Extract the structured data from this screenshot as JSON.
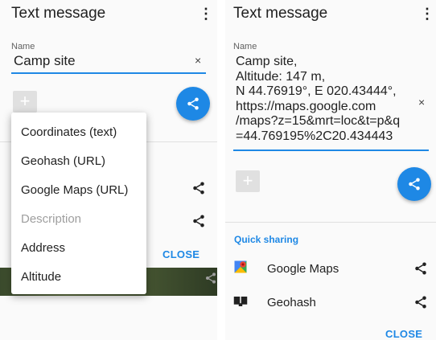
{
  "left": {
    "title": "Text message",
    "name_label": "Name",
    "name_value": "Camp site",
    "clear_glyph": "×",
    "menu_items": [
      {
        "label": "Coordinates (text)",
        "enabled": true
      },
      {
        "label": "Geohash (URL)",
        "enabled": true
      },
      {
        "label": "Google Maps (URL)",
        "enabled": true
      },
      {
        "label": "Description",
        "enabled": false
      },
      {
        "label": "Address",
        "enabled": true
      },
      {
        "label": "Altitude",
        "enabled": true
      }
    ],
    "close_label": "CLOSE"
  },
  "right": {
    "title": "Text message",
    "name_label": "Name",
    "message_lines": [
      "Camp site,",
      "Altitude: 147 m,",
      "N 44.76919°, E 020.43444°,",
      "https://maps.google.com",
      "/maps?z=15&mrt=loc&t=p&q",
      "=44.769195%2C20.434443"
    ],
    "clear_glyph": "×",
    "quick_sharing_title": "Quick sharing",
    "quick_items": [
      {
        "label": "Google Maps",
        "icon": "google-maps-pin-icon"
      },
      {
        "label": "Geohash",
        "icon": "geohash-icon"
      }
    ],
    "close_label": "CLOSE"
  },
  "colors": {
    "accent": "#1e88e5",
    "divider": "#e0e0e0"
  }
}
